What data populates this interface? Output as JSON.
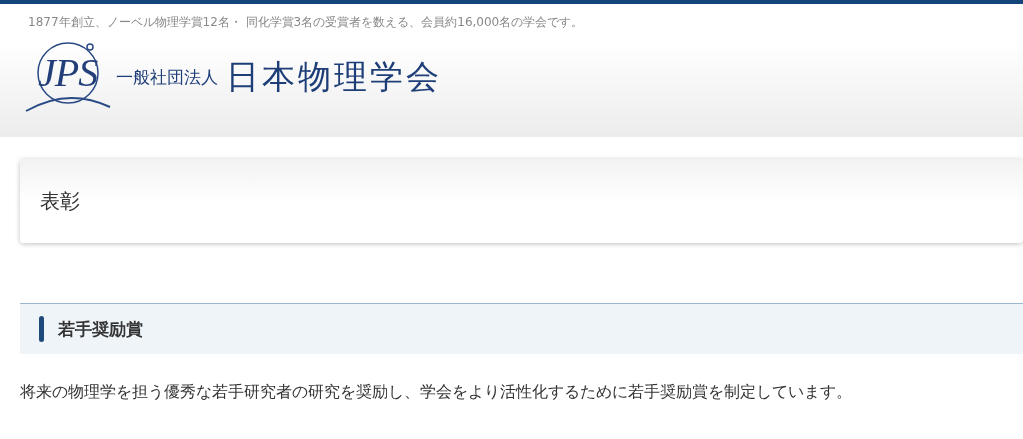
{
  "header": {
    "tagline": "1877年創立、ノーベル物理学賞12名・ 同化学賞3名の受賞者を数える、会員約16,000名の学会です。",
    "logo": {
      "mark": "JPS",
      "org_type": "一般社団法人",
      "name": "日本物理学会"
    }
  },
  "page_title": "表彰",
  "section": {
    "heading": "若手奨励賞",
    "paragraph": "将来の物理学を担う優秀な若手研究者の研究を奨励し、学会をより活性化するために若手奨励賞を制定しています。"
  }
}
